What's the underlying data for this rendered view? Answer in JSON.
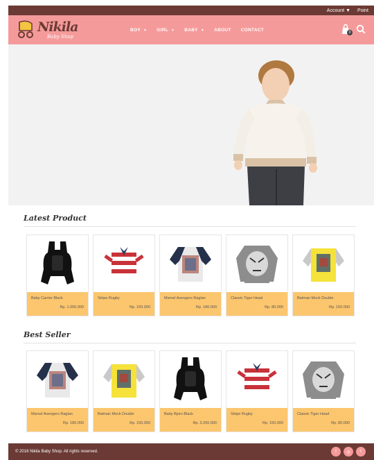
{
  "topbar": {
    "account_label": "Account",
    "point_label": "Point"
  },
  "brand": {
    "logo_text": "Nikila",
    "logo_sub": "Baby Shop"
  },
  "nav": {
    "items": [
      {
        "label": "BOY",
        "dropdown": true
      },
      {
        "label": "GIRL",
        "dropdown": true
      },
      {
        "label": "BABY",
        "dropdown": true
      },
      {
        "label": "ABOUT",
        "dropdown": false
      },
      {
        "label": "CONTACT",
        "dropdown": false
      }
    ],
    "cart_count": "0"
  },
  "sections": {
    "latest": {
      "title": "Latest Product",
      "products": [
        {
          "name": "Baby Carrier Black",
          "price": "Rp. 1.000.000",
          "icon": "baby-carrier-black"
        },
        {
          "name": "Stripe Rugby",
          "price": "Rp. 150.000",
          "icon": "striped-rugby-shirt"
        },
        {
          "name": "Marvel Avengers Raglan",
          "price": "Rp. 180.000",
          "icon": "raglan-shirt-navy"
        },
        {
          "name": "Classic Tiger Head",
          "price": "Rp. 80.000",
          "icon": "tiger-head-shirt"
        },
        {
          "name": "Batman Mock Double",
          "price": "Rp. 150.000",
          "icon": "yellow-batman-shirt"
        }
      ]
    },
    "best": {
      "title": "Best Seller",
      "products": [
        {
          "name": "Marvel Avengers Raglan",
          "price": "Rp. 180.000",
          "icon": "raglan-shirt-navy"
        },
        {
          "name": "Batman Mock Double",
          "price": "Rp. 150.000",
          "icon": "yellow-batman-shirt"
        },
        {
          "name": "Baby Bjorn Black",
          "price": "Rp. 3.200.000",
          "icon": "baby-carrier-black"
        },
        {
          "name": "Stripe Rugby",
          "price": "Rp. 150.000",
          "icon": "striped-rugby-shirt"
        },
        {
          "name": "Classic Tiger Head",
          "price": "Rp. 80.000",
          "icon": "tiger-head-shirt"
        }
      ]
    }
  },
  "footer": {
    "copyright": "© 2016 Nikila Baby Shop. All rights reserved.",
    "socials": [
      {
        "label": "f",
        "icon": "facebook-icon"
      },
      {
        "label": "◎",
        "icon": "instagram-icon"
      },
      {
        "label": "t",
        "icon": "twitter-icon"
      }
    ]
  },
  "colors": {
    "topbar": "#6b3a34",
    "nav": "#f59a9a",
    "card_info": "#fcc66e",
    "footer": "#6b3a34"
  }
}
